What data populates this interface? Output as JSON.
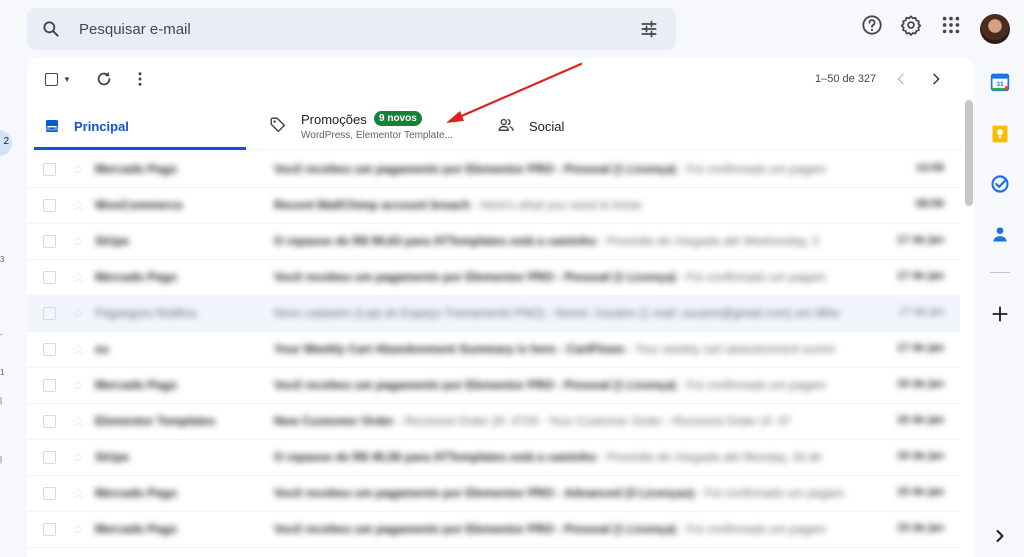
{
  "search": {
    "placeholder": "Pesquisar e-mail",
    "icon": "search-icon",
    "options_icon": "tune-icon"
  },
  "header_icons": [
    "help-icon",
    "settings-icon",
    "apps-grid-icon",
    "avatar"
  ],
  "toolbar": {
    "pagination": "1–50 de 327"
  },
  "tabs": {
    "principal": {
      "label": "Principal"
    },
    "promocoes": {
      "label": "Promoções",
      "badge": "9 novos",
      "snippet": "WordPress, Elementor Template..."
    },
    "social": {
      "label": "Social"
    }
  },
  "emails": [
    {
      "sender": "Mercado Pago",
      "subject": "Você recebeu um pagamento por Elementor PRO - Pessoal (1 Licença)",
      "snippet": " - Foi confirmado um pagam",
      "date": "14:09",
      "read": false
    },
    {
      "sender": "WooCommerce",
      "subject": "Recent MailChimp account breach",
      "snippet": " - Here's what you need to know",
      "date": "08:55",
      "read": false
    },
    {
      "sender": "Stripe",
      "subject": "O repasse de R$ 99,63 para ATTemplates está a caminho",
      "snippet": " - Previsão de chegada até Wednesday, 2",
      "date": "17 de jan",
      "read": false
    },
    {
      "sender": "Mercado Pago",
      "subject": "Você recebeu um pagamento por Elementor PRO - Pessoal (1 Licença)",
      "snippet": " - Foi confirmado um pagam",
      "date": "17 de jan",
      "read": false
    },
    {
      "sender": "Pagseguro Notifica",
      "subject": "Novo cadastro (Loja do Espaço Treinamento PNO)",
      "snippet": " - Nome: Usuário (1 mail: usuario@gmail.com) em Whe",
      "date": "17 de jan",
      "read": true
    },
    {
      "sender": "eu",
      "subject": "Your Weekly Cart Abandonment Summary is here - CartFlows",
      "snippet": " - Your weekly cart abandonment summ",
      "date": "17 de jan",
      "read": false
    },
    {
      "sender": "Mercado Pago",
      "subject": "Você recebeu um pagamento por Elementor PRO - Pessoal (1 Licença)",
      "snippet": " - Foi confirmado um pagam",
      "date": "16 de jan",
      "read": false
    },
    {
      "sender": "Elementor Templates",
      "subject": "New Customer Order",
      "snippet": " - Received Order (R: 4729 - Your Customer Order - Received Order (4: 47",
      "date": "16 de jan",
      "read": false
    },
    {
      "sender": "Stripe",
      "subject": "O repasse de R$ 45,56 para ATTemplates está a caminho",
      "snippet": " - Previsão de chegada até Monday, 16 de",
      "date": "16 de jan",
      "read": false
    },
    {
      "sender": "Mercado Pago",
      "subject": "Você recebeu um pagamento por Elementor PRO - Advanced (3 Licenças)",
      "snippet": " - Foi confirmado um pagam",
      "date": "15 de jan",
      "read": false
    },
    {
      "sender": "Mercado Pago",
      "subject": "Você recebeu um pagamento por Elementor PRO - Pessoal (1 Licença)",
      "snippet": " - Foi confirmado um pagam",
      "date": "15 de jan",
      "read": false
    }
  ],
  "side_apps": [
    "calendar-icon",
    "keep-icon",
    "tasks-icon",
    "contacts-icon",
    "add-icon",
    "expand-icon"
  ],
  "colors": {
    "accent": "#0b57d0",
    "badge": "#188038",
    "arrow": "#e02020"
  }
}
